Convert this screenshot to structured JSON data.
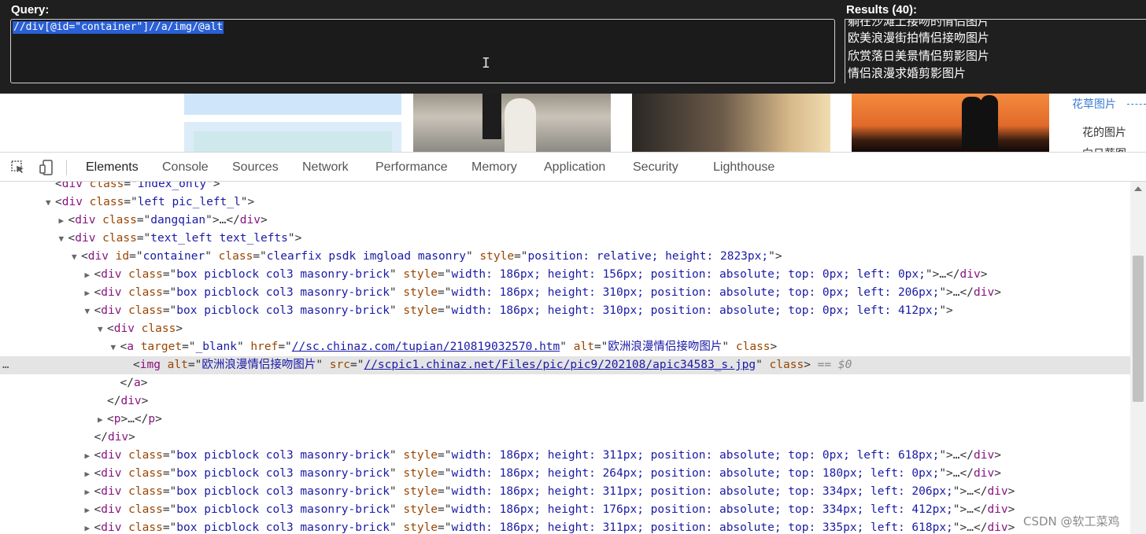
{
  "xpath_helper": {
    "query_label": "Query:",
    "query_text": "//div[@id=\"container\"]//a/img/@alt",
    "results_label": "Results (40):",
    "results": [
      "躺在沙滩上接吻的情侣图片",
      "欧美浪漫街拍情侣接吻图片",
      "欣赏落日美景情侣剪影图片",
      "情侣浪漫求婚剪影图片"
    ]
  },
  "page": {
    "sidebar_title": "花草图片",
    "sidebar_links": [
      "花的图片",
      "向日葵图"
    ]
  },
  "devtools": {
    "tabs": [
      "Elements",
      "Console",
      "Sources",
      "Network",
      "Performance",
      "Memory",
      "Application",
      "Security",
      "Lighthouse"
    ],
    "active_tab": "Elements",
    "lines": [
      {
        "ind": 4,
        "tri": "",
        "parts": [
          [
            "pl",
            "<"
          ],
          [
            "tag",
            "div"
          ],
          [
            "an",
            " class"
          ],
          [
            "pl",
            "=\""
          ],
          [
            "av",
            "index_only"
          ],
          [
            "pl",
            "\">"
          ]
        ]
      },
      {
        "ind": 4,
        "tri": "▼",
        "parts": [
          [
            "pl",
            "<"
          ],
          [
            "tag",
            "div"
          ],
          [
            "an",
            " class"
          ],
          [
            "pl",
            "=\""
          ],
          [
            "av",
            "left pic_left_l"
          ],
          [
            "pl",
            "\">"
          ]
        ]
      },
      {
        "ind": 5,
        "tri": "▶",
        "parts": [
          [
            "pl",
            "<"
          ],
          [
            "tag",
            "div"
          ],
          [
            "an",
            " class"
          ],
          [
            "pl",
            "=\""
          ],
          [
            "av",
            "dangqian"
          ],
          [
            "pl",
            "\">…</"
          ],
          [
            "tag",
            "div"
          ],
          [
            "pl",
            ">"
          ]
        ]
      },
      {
        "ind": 5,
        "tri": "▼",
        "parts": [
          [
            "pl",
            "<"
          ],
          [
            "tag",
            "div"
          ],
          [
            "an",
            " class"
          ],
          [
            "pl",
            "=\""
          ],
          [
            "av",
            "text_left text_lefts"
          ],
          [
            "pl",
            "\">"
          ]
        ]
      },
      {
        "ind": 6,
        "tri": "▼",
        "parts": [
          [
            "pl",
            "<"
          ],
          [
            "tag",
            "div"
          ],
          [
            "an",
            " id"
          ],
          [
            "pl",
            "=\""
          ],
          [
            "av",
            "container"
          ],
          [
            "pl",
            "\" "
          ],
          [
            "an",
            "class"
          ],
          [
            "pl",
            "=\""
          ],
          [
            "av",
            "clearfix psdk imgload masonry"
          ],
          [
            "pl",
            "\" "
          ],
          [
            "an",
            "style"
          ],
          [
            "pl",
            "=\""
          ],
          [
            "av",
            "position: relative; height: 2823px;"
          ],
          [
            "pl",
            "\">"
          ]
        ]
      },
      {
        "ind": 7,
        "tri": "▶",
        "parts": [
          [
            "pl",
            "<"
          ],
          [
            "tag",
            "div"
          ],
          [
            "an",
            " class"
          ],
          [
            "pl",
            "=\""
          ],
          [
            "av",
            "box picblock col3 masonry-brick"
          ],
          [
            "pl",
            "\" "
          ],
          [
            "an",
            "style"
          ],
          [
            "pl",
            "=\""
          ],
          [
            "av",
            "width: 186px; height: 156px; position: absolute; top: 0px; left: 0px;"
          ],
          [
            "pl",
            "\">…</"
          ],
          [
            "tag",
            "div"
          ],
          [
            "pl",
            ">"
          ]
        ]
      },
      {
        "ind": 7,
        "tri": "▶",
        "parts": [
          [
            "pl",
            "<"
          ],
          [
            "tag",
            "div"
          ],
          [
            "an",
            " class"
          ],
          [
            "pl",
            "=\""
          ],
          [
            "av",
            "box picblock col3 masonry-brick"
          ],
          [
            "pl",
            "\" "
          ],
          [
            "an",
            "style"
          ],
          [
            "pl",
            "=\""
          ],
          [
            "av",
            "width: 186px; height: 310px; position: absolute; top: 0px; left: 206px;"
          ],
          [
            "pl",
            "\">…</"
          ],
          [
            "tag",
            "div"
          ],
          [
            "pl",
            ">"
          ]
        ]
      },
      {
        "ind": 7,
        "tri": "▼",
        "parts": [
          [
            "pl",
            "<"
          ],
          [
            "tag",
            "div"
          ],
          [
            "an",
            " class"
          ],
          [
            "pl",
            "=\""
          ],
          [
            "av",
            "box picblock col3 masonry-brick"
          ],
          [
            "pl",
            "\" "
          ],
          [
            "an",
            "style"
          ],
          [
            "pl",
            "=\""
          ],
          [
            "av",
            "width: 186px; height: 310px; position: absolute; top: 0px; left: 412px;"
          ],
          [
            "pl",
            "\">"
          ]
        ]
      },
      {
        "ind": 8,
        "tri": "▼",
        "parts": [
          [
            "pl",
            "<"
          ],
          [
            "tag",
            "div"
          ],
          [
            "an",
            " class"
          ],
          [
            "pl",
            ">"
          ]
        ]
      },
      {
        "ind": 9,
        "tri": "▼",
        "parts": [
          [
            "pl",
            "<"
          ],
          [
            "tag",
            "a"
          ],
          [
            "an",
            " target"
          ],
          [
            "pl",
            "=\""
          ],
          [
            "av",
            "_blank"
          ],
          [
            "pl",
            "\" "
          ],
          [
            "an",
            "href"
          ],
          [
            "pl",
            "=\""
          ],
          [
            "lnk",
            "//sc.chinaz.com/tupian/210819032570.htm"
          ],
          [
            "pl",
            "\" "
          ],
          [
            "an",
            "alt"
          ],
          [
            "pl",
            "=\""
          ],
          [
            "av",
            "欧洲浪漫情侣接吻图片"
          ],
          [
            "pl",
            "\" "
          ],
          [
            "an",
            "class"
          ],
          [
            "pl",
            ">"
          ]
        ]
      },
      {
        "ind": 10,
        "tri": "",
        "sel": true,
        "parts": [
          [
            "pl",
            "<"
          ],
          [
            "tag",
            "img"
          ],
          [
            "an",
            " alt"
          ],
          [
            "pl",
            "=\""
          ],
          [
            "av",
            "欧洲浪漫情侣接吻图片"
          ],
          [
            "pl",
            "\" "
          ],
          [
            "an",
            "src"
          ],
          [
            "pl",
            "=\""
          ],
          [
            "lnk",
            "//scpic1.chinaz.net/Files/pic/pic9/202108/apic34583_s.jpg"
          ],
          [
            "pl",
            "\" "
          ],
          [
            "an",
            "class"
          ],
          [
            "pl",
            "> "
          ],
          [
            "eq",
            "== $0"
          ]
        ]
      },
      {
        "ind": 9,
        "tri": "",
        "parts": [
          [
            "pl",
            "</"
          ],
          [
            "tag",
            "a"
          ],
          [
            "pl",
            ">"
          ]
        ]
      },
      {
        "ind": 8,
        "tri": "",
        "parts": [
          [
            "pl",
            "</"
          ],
          [
            "tag",
            "div"
          ],
          [
            "pl",
            ">"
          ]
        ]
      },
      {
        "ind": 8,
        "tri": "▶",
        "parts": [
          [
            "pl",
            "<"
          ],
          [
            "tag",
            "p"
          ],
          [
            "pl",
            ">…</"
          ],
          [
            "tag",
            "p"
          ],
          [
            "pl",
            ">"
          ]
        ]
      },
      {
        "ind": 7,
        "tri": "",
        "parts": [
          [
            "pl",
            "</"
          ],
          [
            "tag",
            "div"
          ],
          [
            "pl",
            ">"
          ]
        ]
      },
      {
        "ind": 7,
        "tri": "▶",
        "parts": [
          [
            "pl",
            "<"
          ],
          [
            "tag",
            "div"
          ],
          [
            "an",
            " class"
          ],
          [
            "pl",
            "=\""
          ],
          [
            "av",
            "box picblock col3 masonry-brick"
          ],
          [
            "pl",
            "\" "
          ],
          [
            "an",
            "style"
          ],
          [
            "pl",
            "=\""
          ],
          [
            "av",
            "width: 186px; height: 311px; position: absolute; top: 0px; left: 618px;"
          ],
          [
            "pl",
            "\">…</"
          ],
          [
            "tag",
            "div"
          ],
          [
            "pl",
            ">"
          ]
        ]
      },
      {
        "ind": 7,
        "tri": "▶",
        "parts": [
          [
            "pl",
            "<"
          ],
          [
            "tag",
            "div"
          ],
          [
            "an",
            " class"
          ],
          [
            "pl",
            "=\""
          ],
          [
            "av",
            "box picblock col3 masonry-brick"
          ],
          [
            "pl",
            "\" "
          ],
          [
            "an",
            "style"
          ],
          [
            "pl",
            "=\""
          ],
          [
            "av",
            "width: 186px; height: 264px; position: absolute; top: 180px; left: 0px;"
          ],
          [
            "pl",
            "\">…</"
          ],
          [
            "tag",
            "div"
          ],
          [
            "pl",
            ">"
          ]
        ]
      },
      {
        "ind": 7,
        "tri": "▶",
        "parts": [
          [
            "pl",
            "<"
          ],
          [
            "tag",
            "div"
          ],
          [
            "an",
            " class"
          ],
          [
            "pl",
            "=\""
          ],
          [
            "av",
            "box picblock col3 masonry-brick"
          ],
          [
            "pl",
            "\" "
          ],
          [
            "an",
            "style"
          ],
          [
            "pl",
            "=\""
          ],
          [
            "av",
            "width: 186px; height: 311px; position: absolute; top: 334px; left: 206px;"
          ],
          [
            "pl",
            "\">…</"
          ],
          [
            "tag",
            "div"
          ],
          [
            "pl",
            ">"
          ]
        ]
      },
      {
        "ind": 7,
        "tri": "▶",
        "parts": [
          [
            "pl",
            "<"
          ],
          [
            "tag",
            "div"
          ],
          [
            "an",
            " class"
          ],
          [
            "pl",
            "=\""
          ],
          [
            "av",
            "box picblock col3 masonry-brick"
          ],
          [
            "pl",
            "\" "
          ],
          [
            "an",
            "style"
          ],
          [
            "pl",
            "=\""
          ],
          [
            "av",
            "width: 186px; height: 176px; position: absolute; top: 334px; left: 412px;"
          ],
          [
            "pl",
            "\">…</"
          ],
          [
            "tag",
            "div"
          ],
          [
            "pl",
            ">"
          ]
        ]
      },
      {
        "ind": 7,
        "tri": "▶",
        "parts": [
          [
            "pl",
            "<"
          ],
          [
            "tag",
            "div"
          ],
          [
            "an",
            " class"
          ],
          [
            "pl",
            "=\""
          ],
          [
            "av",
            "box picblock col3 masonry-brick"
          ],
          [
            "pl",
            "\" "
          ],
          [
            "an",
            "style"
          ],
          [
            "pl",
            "=\""
          ],
          [
            "av",
            "width: 186px; height: 311px; position: absolute; top: 335px; left: 618px;"
          ],
          [
            "pl",
            "\">…</"
          ],
          [
            "tag",
            "div"
          ],
          [
            "pl",
            ">"
          ]
        ]
      }
    ],
    "row_menu": "…"
  },
  "watermark": "CSDN @软工菜鸡"
}
